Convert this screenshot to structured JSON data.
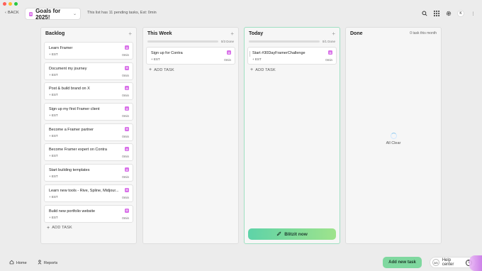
{
  "topbar": {
    "back_label": "BACK",
    "list_badge": "G",
    "list_title": "Goals for 2025!",
    "pending_text": "This list has 11 pending tasks, Est: 0min",
    "avatar_letter": "K"
  },
  "columns": {
    "backlog": {
      "title": "Backlog",
      "cards": [
        {
          "title": "Learn Framer",
          "badge": "G",
          "est": "+ EST",
          "time": "0min"
        },
        {
          "title": "Document my journey",
          "badge": "G",
          "est": "+ EST",
          "time": "0min"
        },
        {
          "title": "Post & build brand on X",
          "badge": "G",
          "est": "+ EST",
          "time": "0min"
        },
        {
          "title": "Sign up my first Framer client",
          "badge": "G",
          "est": "+ EST",
          "time": "0min"
        },
        {
          "title": "Become a Framer partner",
          "badge": "G",
          "est": "+ EST",
          "time": "0min"
        },
        {
          "title": "Become Framer expert on Contra",
          "badge": "G",
          "est": "+ EST",
          "time": "0min"
        },
        {
          "title": "Start building templates",
          "badge": "G",
          "est": "+ EST",
          "time": "0min"
        },
        {
          "title": "Learn new tools - Rive, Spline, Midjour...",
          "badge": "G",
          "est": "+ EST",
          "time": "0min"
        },
        {
          "title": "Build new portfolio website",
          "badge": "G",
          "est": "+ EST",
          "time": "0min"
        }
      ],
      "add_task": "ADD TASK"
    },
    "this_week": {
      "title": "This Week",
      "progress_label": "0/3 Done",
      "progress": 0,
      "cards": [
        {
          "title": "Sign up for Contra",
          "badge": "G",
          "est": "+ EST",
          "time": "0min"
        }
      ],
      "add_task": "ADD TASK"
    },
    "today": {
      "title": "Today",
      "progress_label": "0/1 Done",
      "progress": 0,
      "cards": [
        {
          "title": "Start #30DayFramerChallenge",
          "badge": "G",
          "est": "+ EST",
          "time": "0min"
        }
      ],
      "add_task": "ADD TASK",
      "blitz_label": "Blitzit now"
    },
    "done": {
      "title": "Done",
      "meta": "0 task this month",
      "empty_text": "All Clear"
    }
  },
  "bottombar": {
    "home_label": "Home",
    "reports_label": "Reports",
    "new_task_label": "Add new task",
    "help_count": "3/5",
    "help_label": "Help center"
  },
  "colors": {
    "badge": "#d86fe8",
    "accent_green": "#7fd89f",
    "today_border": "#9fe0c2"
  }
}
